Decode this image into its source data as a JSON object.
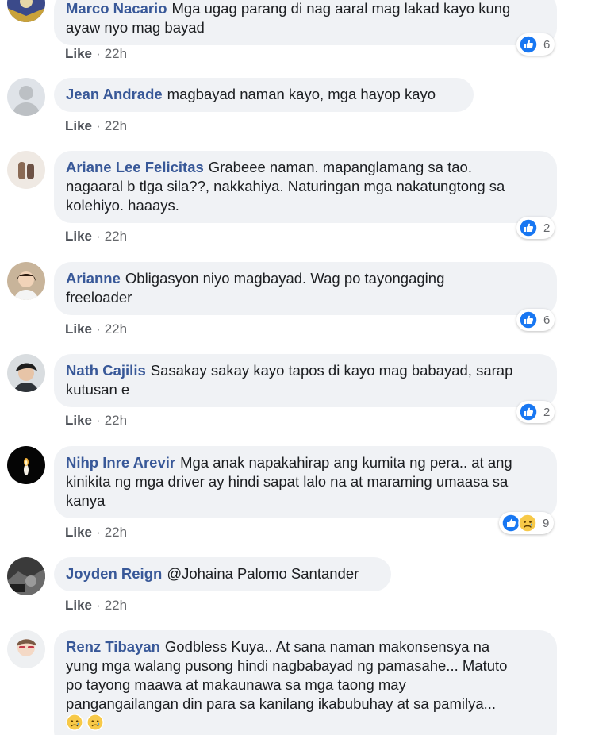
{
  "like_label": "Like",
  "separator": "·",
  "comments": [
    {
      "author": "Marco Nacario",
      "text": "Mga ugag parang di nag aaral mag lakad kayo kung\nayaw nyo mag bayad",
      "time": "22h",
      "reaction_count": "6",
      "reactions": [
        "like-icon"
      ]
    },
    {
      "author": "Jean Andrade",
      "text": "magbayad naman kayo, mga hayop kayo",
      "time": "22h"
    },
    {
      "author": "Ariane Lee Felicitas",
      "text": "Grabeee naman. mapanglamang sa tao.\nnagaaral b tlga sila??, nakkahiya. Naturingan mga nakatungtong sa\nkolehiyo. haaays.",
      "time": "22h",
      "reaction_count": "2",
      "reactions": [
        "like-icon"
      ]
    },
    {
      "author": "Arianne",
      "text": "Obligasyon niyo magbayad. Wag po tayongaging\nfreeloader",
      "time": "22h",
      "reaction_count": "6",
      "reactions": [
        "like-icon"
      ]
    },
    {
      "author": "Nath Cajilis",
      "text": "Sasakay sakay kayo tapos di kayo mag babayad, sarap\nkutusan e",
      "time": "22h",
      "reaction_count": "2",
      "reactions": [
        "like-icon"
      ]
    },
    {
      "author": "Nihp Inre Arevir",
      "text": "Mga anak napakahirap ang kumita ng pera.. at ang\nkinikita ng mga driver ay hindi sapat lalo na at maraming umaasa sa\nkanya",
      "time": "22h",
      "reaction_count": "9",
      "reactions": [
        "like-icon",
        "sad-icon"
      ]
    },
    {
      "author": "Joyden Reign",
      "text": "@Johaina Palomo Santander",
      "time": "22h"
    },
    {
      "author": "Renz Tibayan",
      "text": "Godbless Kuya.. At sana naman makonsensya na\nyung mga walang pusong hindi nagbabayad ng pamasahe... Matuto\npo tayong maawa at makaunawa sa mga taong may\npangangailangan din para sa kanilang ikabubuhay at sa pamilya...",
      "trailing_emojis": [
        "sad-icon",
        "sad-icon"
      ]
    }
  ]
}
